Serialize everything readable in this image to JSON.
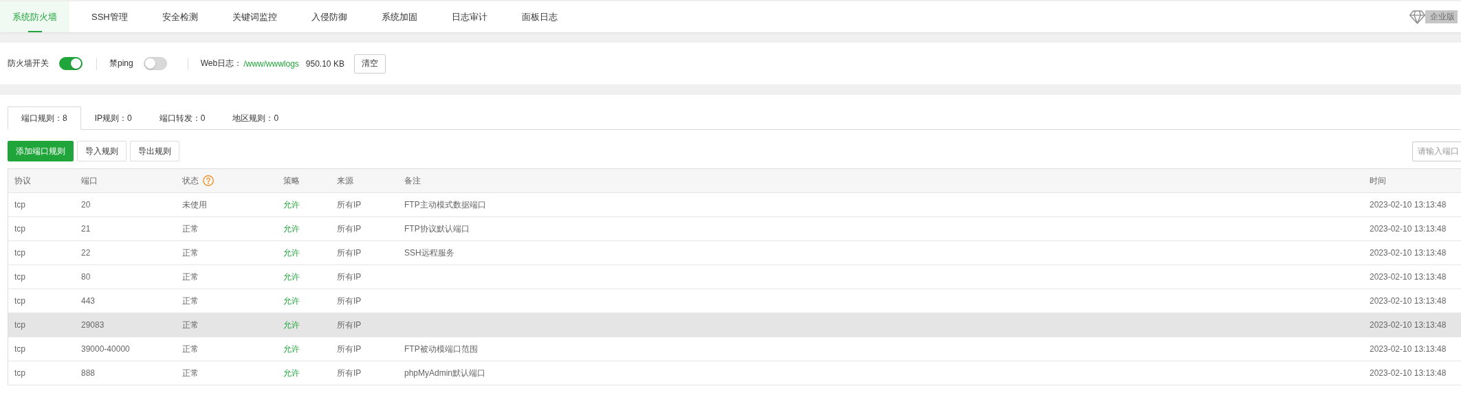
{
  "nav": {
    "tabs": [
      {
        "label": "系统防火墙",
        "selected": true
      },
      {
        "label": "SSH管理",
        "selected": false
      },
      {
        "label": "安全检测",
        "selected": false
      },
      {
        "label": "关键词监控",
        "selected": false
      },
      {
        "label": "入侵防御",
        "selected": false
      },
      {
        "label": "系统加固",
        "selected": false
      },
      {
        "label": "日志审计",
        "selected": false
      },
      {
        "label": "面板日志",
        "selected": false
      }
    ],
    "edition_badge": "企业版"
  },
  "firewall_settings": {
    "toggles": [
      {
        "label": "防火墙开关",
        "on": true
      },
      {
        "label": "禁ping",
        "on": false
      }
    ],
    "web_log": {
      "label": "Web日志：",
      "path": "/www/wwwlogs",
      "size": "950.10 KB",
      "clear_button": "清空"
    }
  },
  "rules": {
    "tabs": [
      {
        "label": "端口规则：8",
        "selected": true
      },
      {
        "label": "IP规则：0",
        "selected": false
      },
      {
        "label": "端口转发：0",
        "selected": false
      },
      {
        "label": "地区规则：0",
        "selected": false
      }
    ],
    "buttons": [
      {
        "label": "添加端口规则",
        "kind": "primary"
      },
      {
        "label": "导入规则",
        "kind": "default"
      },
      {
        "label": "导出规则",
        "kind": "default"
      }
    ],
    "search": {
      "placeholder": "请输入端口"
    },
    "table": {
      "columns": [
        {
          "label": "协议",
          "help": false
        },
        {
          "label": "端口",
          "help": false
        },
        {
          "label": "状态",
          "help": true
        },
        {
          "label": "策略",
          "help": false
        },
        {
          "label": "来源",
          "help": false
        },
        {
          "label": "备注",
          "help": false
        },
        {
          "label": "时间",
          "help": false
        }
      ],
      "rows": [
        {
          "protocol": "tcp",
          "port": "20",
          "status": "未使用",
          "policy": "允许",
          "source": "所有IP",
          "remark": "FTP主动模式数据端口",
          "time": "2023-02-10 13:13:48",
          "hovered": false
        },
        {
          "protocol": "tcp",
          "port": "21",
          "status": "正常",
          "policy": "允许",
          "source": "所有IP",
          "remark": "FTP协议默认端口",
          "time": "2023-02-10 13:13:48",
          "hovered": false
        },
        {
          "protocol": "tcp",
          "port": "22",
          "status": "正常",
          "policy": "允许",
          "source": "所有IP",
          "remark": "SSH远程服务",
          "time": "2023-02-10 13:13:48",
          "hovered": false
        },
        {
          "protocol": "tcp",
          "port": "80",
          "status": "正常",
          "policy": "允许",
          "source": "所有IP",
          "time": "2023-02-10 13:13:48",
          "hovered": false
        },
        {
          "protocol": "tcp",
          "port": "443",
          "status": "正常",
          "policy": "允许",
          "source": "所有IP",
          "time": "2023-02-10 13:13:48",
          "hovered": false
        },
        {
          "protocol": "tcp",
          "port": "29083",
          "status": "正常",
          "policy": "允许",
          "source": "所有IP",
          "time": "2023-02-10 13:13:48",
          "hovered": true
        },
        {
          "protocol": "tcp",
          "port": "39000-40000",
          "status": "正常",
          "policy": "允许",
          "source": "所有IP",
          "remark": "FTP被动模端口范围",
          "time": "2023-02-10 13:13:48",
          "hovered": false
        },
        {
          "protocol": "tcp",
          "port": "888",
          "status": "正常",
          "policy": "允许",
          "source": "所有IP",
          "remark": "phpMyAdmin默认端口",
          "time": "2023-02-10 13:13:48",
          "hovered": false
        }
      ]
    }
  }
}
